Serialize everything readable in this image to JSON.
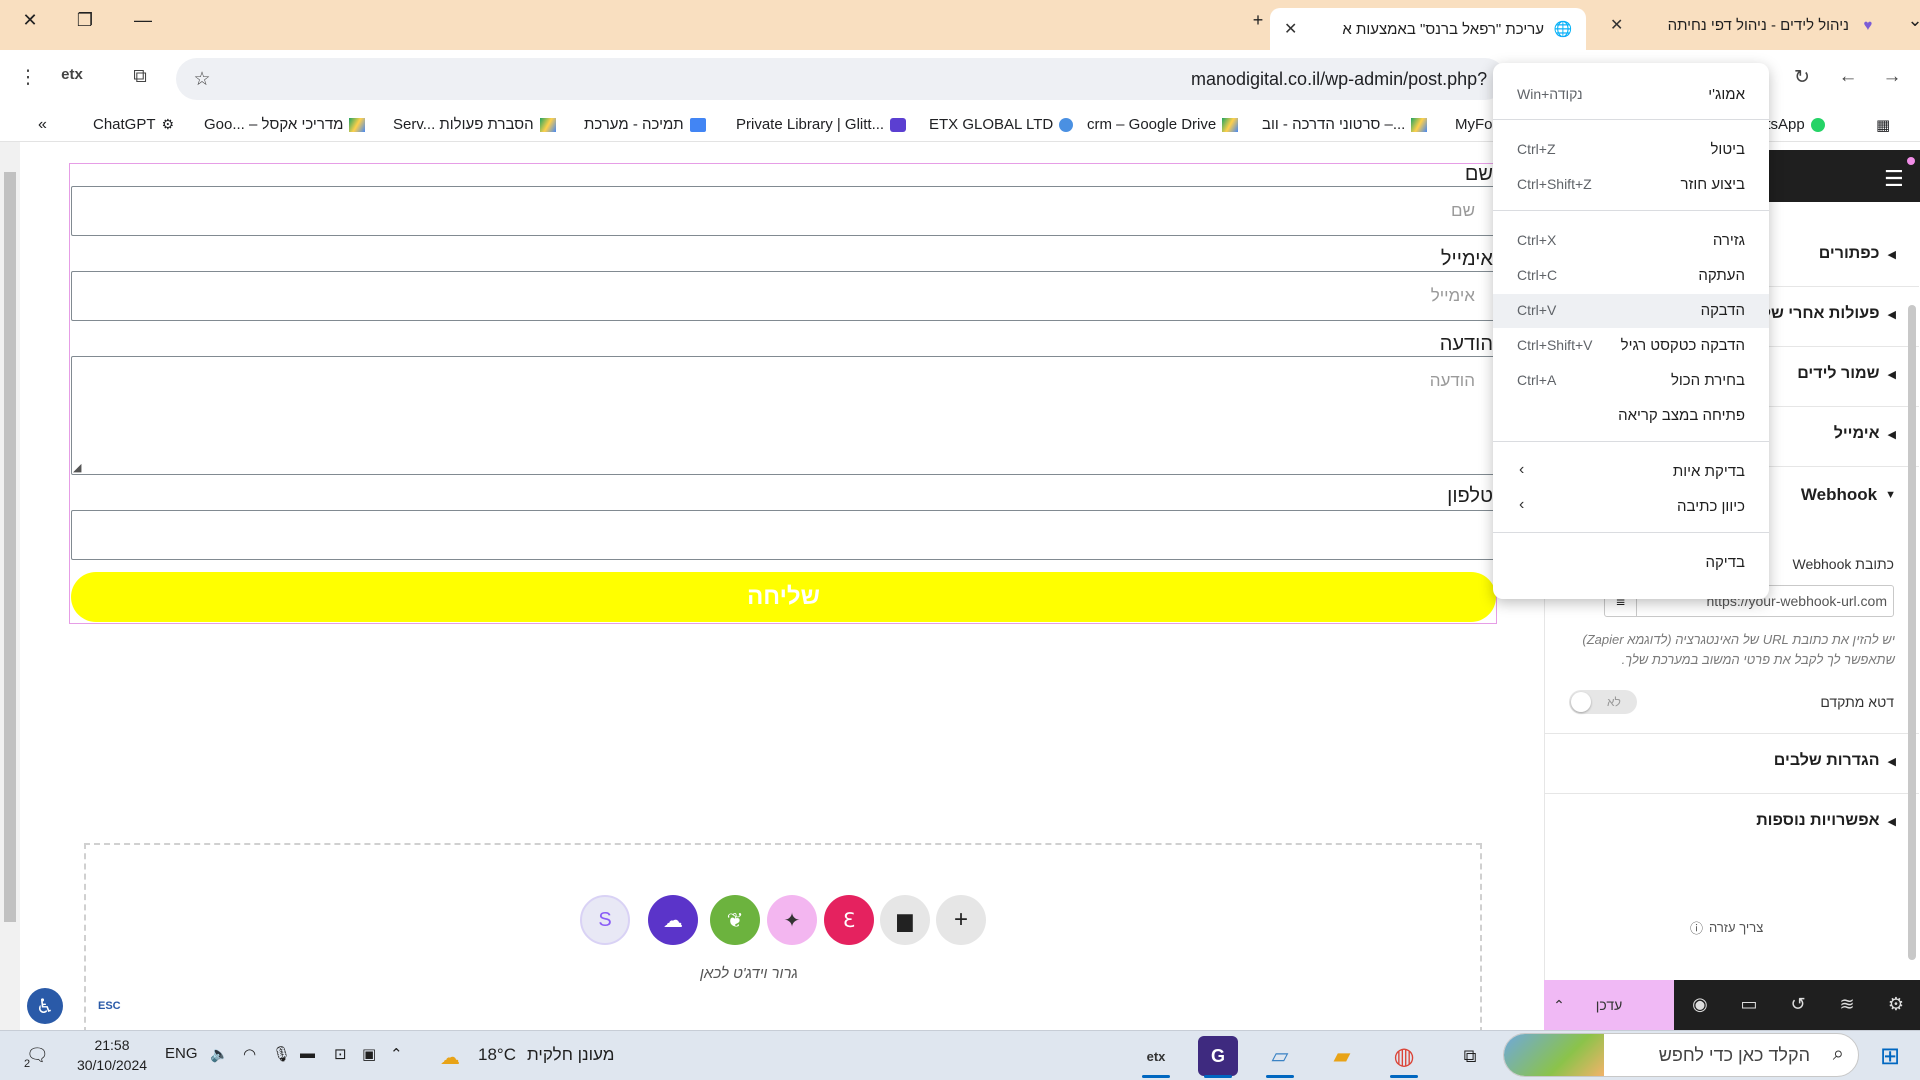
{
  "browser": {
    "tabs": [
      {
        "title": "ניהול לידים - ניהול דפי נחיתה",
        "active": false
      },
      {
        "title": "עריכת \"רפאל ברנס\" באמצעות א",
        "active": true
      }
    ],
    "url": "manodigital.co.il/wp-admin/post.php?",
    "bookmarks": [
      "ChatGPT",
      "Goo... – מדריכי אקסל",
      "Serv... הסברת פעולות",
      "תמיכה - מערכת",
      "Private Library | Glitt...",
      "ETX GLOBAL LTD",
      "crm – Google Drive",
      "סרטוני הדרכה - ווב –...",
      "MyFo",
      "atsApp"
    ]
  },
  "form": {
    "fields": [
      {
        "label": "שם",
        "placeholder": "שם"
      },
      {
        "label": "אימייל",
        "placeholder": "אימייל"
      },
      {
        "label": "הודעה",
        "placeholder": "הודעה"
      },
      {
        "label": "טלפון",
        "placeholder": ""
      }
    ],
    "submit_label": "שליחה",
    "submit_color": "#ffff00"
  },
  "dropzone": {
    "text": "גרור וידג'ט לכאן",
    "buttons": [
      "s-icon",
      "cloud-icon",
      "leaf-icon",
      "sparkle-icon",
      "ek-icon",
      "folder-icon",
      "plus-icon"
    ]
  },
  "a11y": {
    "esc": "ESC"
  },
  "panel": {
    "sections": [
      "כפתורים",
      "פעולות אחרי של",
      "שמור לידים",
      "אימייל",
      "Webhook",
      "הגדרות שלבים",
      "אפשרויות נוספות"
    ],
    "webhook": {
      "url_label": "כתובת Webhook",
      "url_value": "https://your-webhook-url.com",
      "help": "יש להזין את כתובת URL של האינטגרציה (לדוגמא Zapier) שתאפשר לך לקבל את פרטי המשוב במערכת שלך.",
      "advanced_label": "דטא מתקדם",
      "toggle_text": "לא"
    },
    "help_link": "צריך עזרה",
    "update_label": "עדכן",
    "accent": "#f0b9f5"
  },
  "context_menu": {
    "items": [
      {
        "label": "אמוג'י",
        "shortcut": "Win+נקודה"
      },
      {
        "label": "ביטול",
        "shortcut": "Ctrl+Z"
      },
      {
        "label": "ביצוע חוזר",
        "shortcut": "Ctrl+Shift+Z"
      },
      {
        "label": "גזירה",
        "shortcut": "Ctrl+X"
      },
      {
        "label": "העתקה",
        "shortcut": "Ctrl+C"
      },
      {
        "label": "הדבקה",
        "shortcut": "Ctrl+V"
      },
      {
        "label": "הדבקה כטקסט רגיל",
        "shortcut": "Ctrl+Shift+V"
      },
      {
        "label": "בחירת הכול",
        "shortcut": "Ctrl+A"
      },
      {
        "label": "פתיחה במצב קריאה",
        "shortcut": ""
      },
      {
        "label": "בדיקת איות",
        "shortcut": ""
      },
      {
        "label": "כיוון כתיבה",
        "shortcut": ""
      },
      {
        "label": "בדיקה",
        "shortcut": ""
      }
    ]
  },
  "taskbar": {
    "search_text": "הקלד כאן כדי לחפש",
    "weather_temp": "18°C",
    "weather_text": "מעונן חלקית",
    "lang": "ENG",
    "time": "21:58",
    "date": "30/10/2024",
    "notifications": "2"
  }
}
